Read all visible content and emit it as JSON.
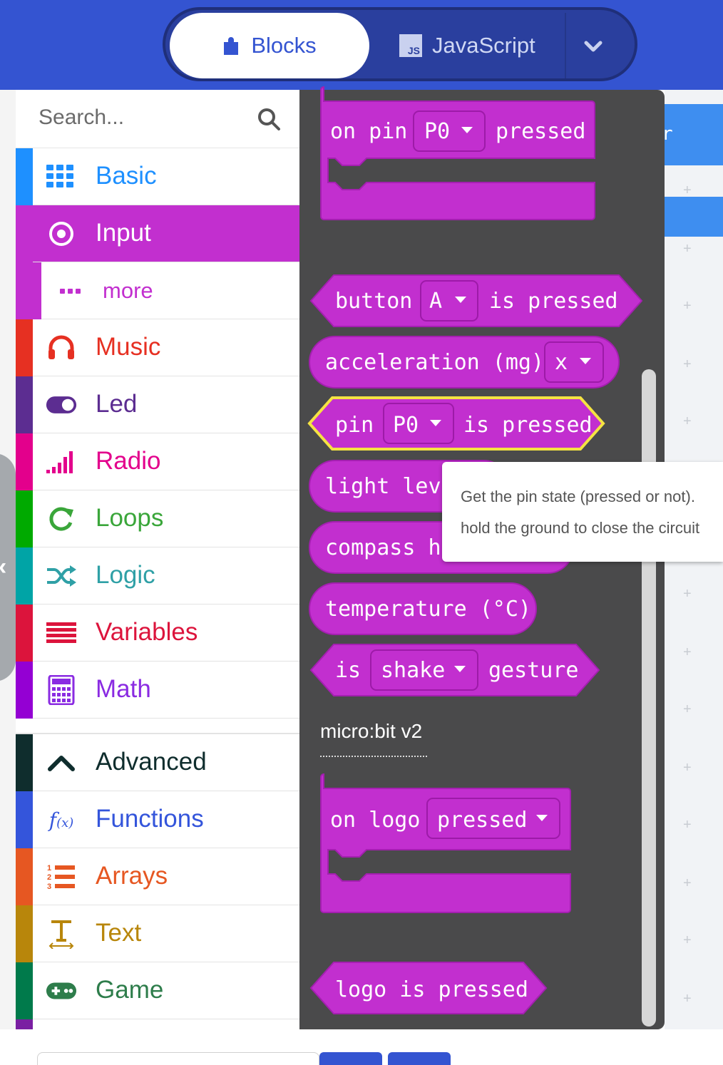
{
  "header": {
    "tabs": [
      {
        "label": "Blocks",
        "icon": "puzzle-icon",
        "active": true
      },
      {
        "label": "JavaScript",
        "icon": "js-icon",
        "active": false
      }
    ],
    "js_badge": "JS"
  },
  "toolbox": {
    "search_placeholder": "Search...",
    "categories": [
      {
        "label": "Basic",
        "icon": "grid-icon",
        "color": "#1e90ff"
      },
      {
        "label": "Input",
        "icon": "target-icon",
        "color": "#c22fcf",
        "selected": true
      },
      {
        "label": "more",
        "icon": "ellipsis-icon",
        "color": "#c22fcf"
      },
      {
        "label": "Music",
        "icon": "headphones-icon",
        "color": "#e63022"
      },
      {
        "label": "Led",
        "icon": "toggle-icon",
        "color": "#5c2d91"
      },
      {
        "label": "Radio",
        "icon": "signal-bars-icon",
        "color": "#e3008c"
      },
      {
        "label": "Loops",
        "icon": "refresh-icon",
        "color": "#00aa00"
      },
      {
        "label": "Logic",
        "icon": "shuffle-icon",
        "color": "#00a4a6"
      },
      {
        "label": "Variables",
        "icon": "list-lines-icon",
        "color": "#dc143c"
      },
      {
        "label": "Math",
        "icon": "calculator-icon",
        "color": "#9400d3"
      },
      {
        "label": "Advanced",
        "icon": "chevron-up-icon",
        "color": "#0f2d2d"
      },
      {
        "label": "Functions",
        "icon": "function-icon",
        "color": "#3455db"
      },
      {
        "label": "Arrays",
        "icon": "numbered-list-icon",
        "color": "#e65722"
      },
      {
        "label": "Text",
        "icon": "text-icon",
        "color": "#b8860b"
      },
      {
        "label": "Game",
        "icon": "gamepad-icon",
        "color": "#007a4b"
      }
    ]
  },
  "flyout": {
    "blocks": {
      "on_pin": {
        "t1": "on pin",
        "dropdown": "P0",
        "t2": "pressed"
      },
      "button": {
        "t1": "button",
        "dropdown": "A",
        "t2": "is pressed"
      },
      "acceleration": {
        "t1": "acceleration (mg)",
        "dropdown": "x"
      },
      "pin_pressed": {
        "t1": "pin",
        "dropdown": "P0",
        "t2": "is pressed"
      },
      "light_level": {
        "t1": "light level"
      },
      "compass": {
        "t1": "compass heading"
      },
      "temperature": {
        "t1": "temperature (°C)"
      },
      "gesture": {
        "t1": "is",
        "dropdown": "shake",
        "t2": "gesture"
      },
      "on_logo": {
        "t1": "on logo",
        "dropdown": "pressed"
      },
      "logo_pressed": {
        "t1": "logo is pressed"
      }
    },
    "section_label": "micro:bit v2"
  },
  "tooltip": {
    "line1": "Get the pin state (pressed or not).",
    "line2": "hold the ground to close the circuit"
  },
  "colors": {
    "header": "#3454d1",
    "input_block": "#c22fcf",
    "flyout_bg": "#4a4a4b",
    "highlight": "#f5e342"
  }
}
